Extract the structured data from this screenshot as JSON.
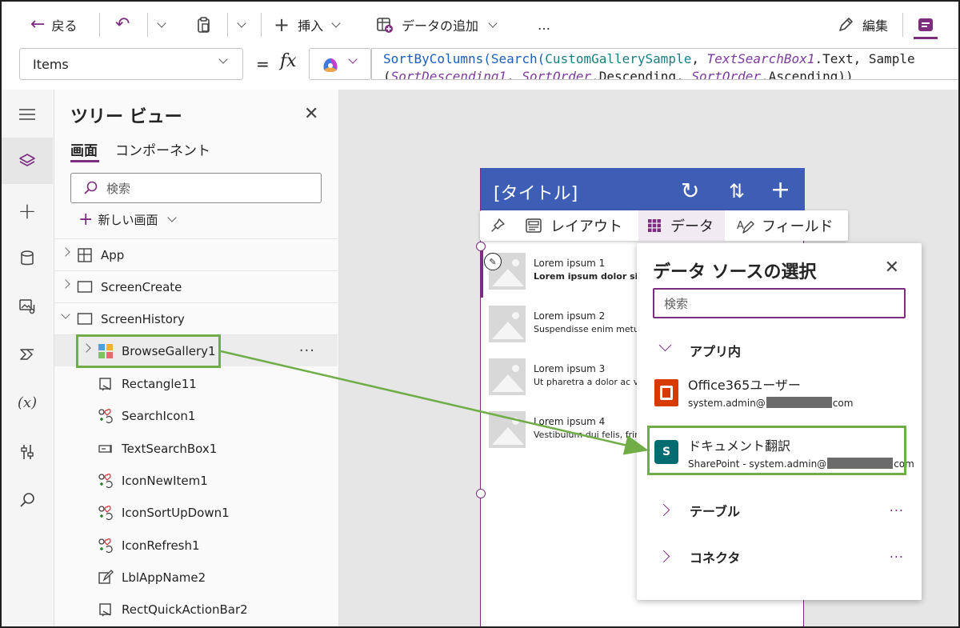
{
  "toolbar": {
    "back_label": "戻る",
    "insert_label": "挿入",
    "add_data_label": "データの追加",
    "more_label": "…",
    "edit_label": "編集"
  },
  "formula_bar": {
    "property": "Items",
    "equals": "=",
    "fx": "fx",
    "line1": [
      {
        "t": "SortByColumns(",
        "c": "fn"
      },
      {
        "t": "Search(",
        "c": "fn"
      },
      {
        "t": "CustomGallerySample",
        "c": "id"
      },
      {
        "t": ", ",
        "c": "tx"
      },
      {
        "t": "TextSearchBox1",
        "c": "it"
      },
      {
        "t": ".Text, Sample",
        "c": "tx"
      }
    ],
    "line2": [
      {
        "t": "(",
        "c": "tx"
      },
      {
        "t": "SortDescending1",
        "c": "it"
      },
      {
        "t": ", ",
        "c": "tx"
      },
      {
        "t": "SortOrder",
        "c": "it"
      },
      {
        "t": ".Descending, ",
        "c": "tx"
      },
      {
        "t": "SortOrder",
        "c": "it"
      },
      {
        "t": ".Ascending))",
        "c": "tx"
      }
    ]
  },
  "rail": {
    "items": [
      "menu-icon",
      "layers-icon",
      "plus-icon",
      "database-icon",
      "media-icon",
      "power-automate-icon",
      "variables-icon",
      "tools-icon",
      "search-icon"
    ],
    "variables_text": "(x)"
  },
  "tree": {
    "title": "ツリー ビュー",
    "tabs": [
      "画面",
      "コンポーネント"
    ],
    "search_placeholder": "検索",
    "new_screen": "新しい画面",
    "rows": [
      {
        "label": "App"
      },
      {
        "label": "ScreenCreate"
      },
      {
        "label": "ScreenHistory"
      }
    ],
    "selected": "BrowseGallery1",
    "children": [
      {
        "label": "Rectangle11",
        "icon": "rectangle-icon"
      },
      {
        "label": "SearchIcon1",
        "icon": "icon-icon"
      },
      {
        "label": "TextSearchBox1",
        "icon": "textinput-icon"
      },
      {
        "label": "IconNewItem1",
        "icon": "icon-icon"
      },
      {
        "label": "IconSortUpDown1",
        "icon": "icon-icon"
      },
      {
        "label": "IconRefresh1",
        "icon": "icon-icon"
      },
      {
        "label": "LblAppName2",
        "icon": "label-icon"
      },
      {
        "label": "RectQuickActionBar2",
        "icon": "rectangle-icon"
      }
    ]
  },
  "phone": {
    "title": "[タイトル]",
    "gallery": [
      {
        "title": "Lorem ipsum 1",
        "sub": "Lorem ipsum dolor sit amet",
        "bold": true
      },
      {
        "title": "Lorem ipsum 2",
        "sub": "Suspendisse enim metus, ti",
        "bold": false
      },
      {
        "title": "Lorem ipsum 3",
        "sub": "Ut pharetra a dolor ac vehic",
        "bold": false
      },
      {
        "title": "Lorem ipsum 4",
        "sub": "Vestibulum dui felis, fringill",
        "bold": false
      }
    ]
  },
  "context_bar": {
    "layout": "レイアウト",
    "data": "データ",
    "fields": "フィールド"
  },
  "data_panel": {
    "title": "データ ソースの選択",
    "search_placeholder": "検索",
    "section_in_app": "アプリ内",
    "item1_name": "Office365ユーザー",
    "item1_sub_a": "system.admin@",
    "item1_sub_b": "com",
    "item2_name": "ドキュメント翻訳",
    "item2_sub_a": "SharePoint - system.admin@",
    "item2_sub_b": "com",
    "section_tables": "テーブル",
    "section_connectors": "コネクタ",
    "dots": "..."
  },
  "colors": {
    "accent": "#7b2d7e",
    "header_blue": "#3e5db5",
    "highlight_green": "#70ad47",
    "office_orange": "#d83b01",
    "sharepoint_teal": "#036c70"
  }
}
